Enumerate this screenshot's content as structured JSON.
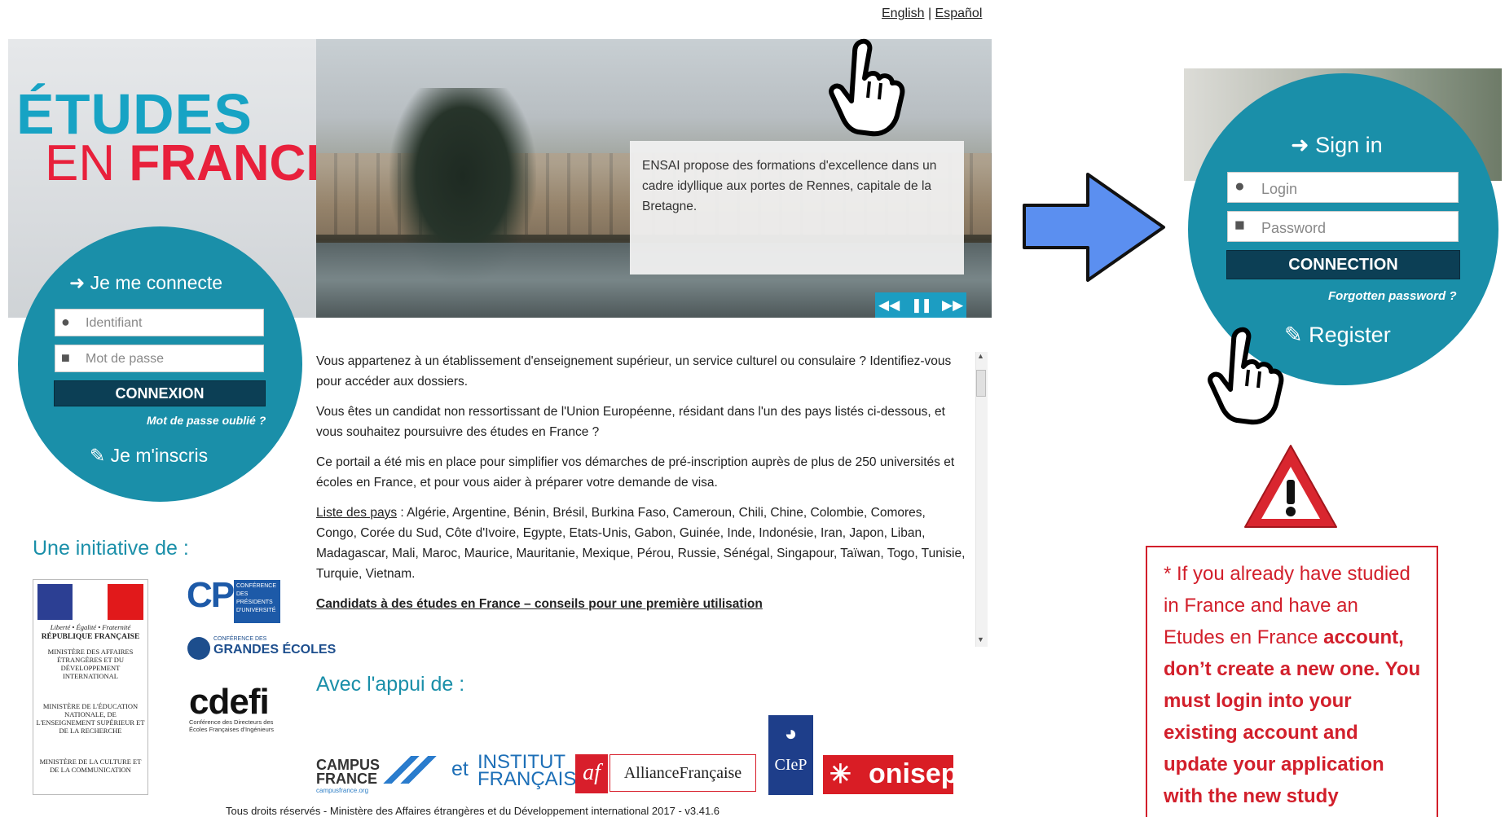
{
  "lang": {
    "english": "English",
    "separator": "|",
    "espanol": "Español"
  },
  "logo": {
    "line1": "ÉTUDES",
    "line2_a": "EN ",
    "line2_b": "FRANCE"
  },
  "hero": {
    "caption": "ENSAI propose des formations d'excellence dans un cadre idyllique aux portes de Rennes, capitale de la Bretagne.",
    "controls": {
      "prev_icon": "fast-backward-icon",
      "pause_icon": "pause-icon",
      "next_icon": "fast-forward-icon"
    }
  },
  "login_fr": {
    "title": "Je me connecte",
    "id_placeholder": "Identifiant",
    "pw_placeholder": "Mot de passe",
    "button": "CONNEXION",
    "forgot": "Mot de passe oublié ?",
    "register": "Je m'inscris"
  },
  "initiative": {
    "title": "Une initiative de :",
    "rf": {
      "motto": "Liberté • Égalité • Fraternité",
      "name": "RÉPUBLIQUE FRANÇAISE",
      "min1": "MINISTÈRE DES AFFAIRES ÉTRANGÈRES ET DU DÉVELOPPEMENT INTERNATIONAL",
      "min2": "MINISTÈRE DE L'ÉDUCATION NATIONALE, DE L'ENSEIGNEMENT SUPÉRIEUR ET DE LA RECHERCHE",
      "min3": "MINISTÈRE DE LA CULTURE ET DE LA COMMUNICATION"
    },
    "cpu": {
      "letters": "CPU",
      "text": "CONFÉRENCE DES PRÉSIDENTS D'UNIVERSITÉ"
    },
    "cge": {
      "name": "GRANDES ÉCOLES",
      "prefix": "CONFÉRENCE DES"
    },
    "cdefi": {
      "name": "cdefi",
      "text": "Conférence des Directeurs des Écoles Françaises d'Ingénieurs"
    }
  },
  "main": {
    "p1": "Vous appartenez à un établissement d'enseignement supérieur, un service culturel ou consulaire ? Identifiez-vous pour accéder aux dossiers.",
    "p2": "Vous êtes un candidat non ressortissant de l'Union Européenne, résidant dans l'un des pays listés ci-dessous, et vous souhaitez poursuivre des études en France ?",
    "p3": "Ce portail a été mis en place pour simplifier vos démarches de pré-inscription auprès de plus de 250 universités et écoles en France, et pour vous aider à préparer votre demande de visa.",
    "countries_label": "Liste des pays",
    "countries": " : Algérie, Argentine, Bénin, Brésil, Burkina Faso, Cameroun, Chili, Chine, Colombie, Comores, Congo, Corée du Sud, Côte d'Ivoire, Egypte, Etats-Unis, Gabon, Guinée, Inde, Indonésie, Iran, Japon, Liban, Madagascar, Mali, Maroc, Maurice, Mauritanie, Mexique, Pérou, Russie, Sénégal, Singapour, Taïwan, Togo, Tunisie, Turquie, Vietnam.",
    "advice_link": "Candidats à des études en France – conseils pour une première utilisation"
  },
  "appui": {
    "title": "Avec l'appui de :",
    "campus": "CAMPUS FRANCE",
    "campus_url": "campusfrance.org",
    "et": "et",
    "institut": "INSTITUT FRANÇAIS",
    "af": "af",
    "alliance": "AllianceFrançaise",
    "ciep": "CIeP",
    "onisep": "onisep"
  },
  "footer": "Tous droits réservés - Ministère des Affaires étrangères et du Développement international 2017 - v3.41.6",
  "login_en": {
    "title": "Sign in",
    "login_placeholder": "Login",
    "password_placeholder": "Password",
    "button": "CONNECTION",
    "forgot": "Forgotten password ?",
    "register": "Register"
  },
  "note": {
    "normal": "* If you already have studied in France and have an Etudes en France",
    "bold": "account, don’t create a new one. You must login into your existing account and update your application with the new study"
  },
  "colors": {
    "teal": "#1a8fa9",
    "dark_button": "#0c3f55",
    "red": "#d21f2b",
    "arrow_blue": "#5b8ff0"
  }
}
